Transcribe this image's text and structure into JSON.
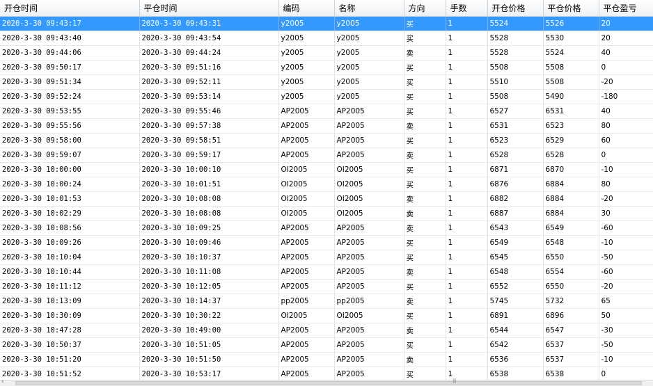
{
  "columns": [
    "开仓时间",
    "平仓时间",
    "编码",
    "名称",
    "方向",
    "手数",
    "开仓价格",
    "平仓价格",
    "平仓盈亏"
  ],
  "selected_row": 0,
  "rows": [
    [
      "2020-3-30 09:43:17",
      "2020-3-30 09:43:31",
      "y2005",
      "y2005",
      "买",
      "1",
      "5524",
      "5526",
      "20"
    ],
    [
      "2020-3-30 09:43:40",
      "2020-3-30 09:43:54",
      "y2005",
      "y2005",
      "买",
      "1",
      "5528",
      "5530",
      "20"
    ],
    [
      "2020-3-30 09:44:06",
      "2020-3-30 09:44:24",
      "y2005",
      "y2005",
      "卖",
      "1",
      "5528",
      "5524",
      "40"
    ],
    [
      "2020-3-30 09:50:17",
      "2020-3-30 09:51:16",
      "y2005",
      "y2005",
      "买",
      "1",
      "5508",
      "5508",
      "0"
    ],
    [
      "2020-3-30 09:51:34",
      "2020-3-30 09:52:11",
      "y2005",
      "y2005",
      "买",
      "1",
      "5510",
      "5508",
      "-20"
    ],
    [
      "2020-3-30 09:52:24",
      "2020-3-30 09:53:14",
      "y2005",
      "y2005",
      "买",
      "1",
      "5508",
      "5490",
      "-180"
    ],
    [
      "2020-3-30 09:53:55",
      "2020-3-30 09:55:46",
      "AP2005",
      "AP2005",
      "买",
      "1",
      "6527",
      "6531",
      "40"
    ],
    [
      "2020-3-30 09:55:56",
      "2020-3-30 09:57:38",
      "AP2005",
      "AP2005",
      "卖",
      "1",
      "6531",
      "6523",
      "80"
    ],
    [
      "2020-3-30 09:58:00",
      "2020-3-30 09:58:51",
      "AP2005",
      "AP2005",
      "买",
      "1",
      "6523",
      "6529",
      "60"
    ],
    [
      "2020-3-30 09:59:07",
      "2020-3-30 09:59:17",
      "AP2005",
      "AP2005",
      "卖",
      "1",
      "6528",
      "6528",
      "0"
    ],
    [
      "2020-3-30 10:00:00",
      "2020-3-30 10:00:10",
      "OI2005",
      "OI2005",
      "买",
      "1",
      "6871",
      "6870",
      "-10"
    ],
    [
      "2020-3-30 10:00:24",
      "2020-3-30 10:01:51",
      "OI2005",
      "OI2005",
      "买",
      "1",
      "6876",
      "6884",
      "80"
    ],
    [
      "2020-3-30 10:01:53",
      "2020-3-30 10:08:08",
      "OI2005",
      "OI2005",
      "卖",
      "1",
      "6882",
      "6884",
      "-20"
    ],
    [
      "2020-3-30 10:02:29",
      "2020-3-30 10:08:08",
      "OI2005",
      "OI2005",
      "卖",
      "1",
      "6887",
      "6884",
      "30"
    ],
    [
      "2020-3-30 10:08:56",
      "2020-3-30 10:09:25",
      "AP2005",
      "AP2005",
      "卖",
      "1",
      "6543",
      "6549",
      "-60"
    ],
    [
      "2020-3-30 10:09:26",
      "2020-3-30 10:09:46",
      "AP2005",
      "AP2005",
      "买",
      "1",
      "6549",
      "6548",
      "-10"
    ],
    [
      "2020-3-30 10:10:04",
      "2020-3-30 10:10:37",
      "AP2005",
      "AP2005",
      "买",
      "1",
      "6545",
      "6550",
      "-50"
    ],
    [
      "2020-3-30 10:10:44",
      "2020-3-30 10:11:08",
      "AP2005",
      "AP2005",
      "卖",
      "1",
      "6548",
      "6554",
      "-60"
    ],
    [
      "2020-3-30 10:11:12",
      "2020-3-30 10:12:05",
      "AP2005",
      "AP2005",
      "买",
      "1",
      "6552",
      "6550",
      "-20"
    ],
    [
      "2020-3-30 10:13:09",
      "2020-3-30 10:14:37",
      "pp2005",
      "pp2005",
      "卖",
      "1",
      "5745",
      "5732",
      "65"
    ],
    [
      "2020-3-30 10:30:09",
      "2020-3-30 10:30:22",
      "OI2005",
      "OI2005",
      "买",
      "1",
      "6891",
      "6896",
      "50"
    ],
    [
      "2020-3-30 10:47:28",
      "2020-3-30 10:49:00",
      "AP2005",
      "AP2005",
      "卖",
      "1",
      "6544",
      "6547",
      "-30"
    ],
    [
      "2020-3-30 10:50:37",
      "2020-3-30 10:51:05",
      "AP2005",
      "AP2005",
      "买",
      "1",
      "6542",
      "6537",
      "-50"
    ],
    [
      "2020-3-30 10:51:20",
      "2020-3-30 10:51:50",
      "AP2005",
      "AP2005",
      "卖",
      "1",
      "6536",
      "6537",
      "-10"
    ],
    [
      "2020-3-30 10:51:52",
      "2020-3-30 10:53:17",
      "AP2005",
      "AP2005",
      "买",
      "1",
      "6538",
      "6538",
      "0"
    ]
  ],
  "scrollbar": {
    "left_arrow": "‹",
    "grip": "⁞⁞⁞"
  },
  "colors": {
    "selection": "#3399ff",
    "selection_text": "#ffffff"
  }
}
